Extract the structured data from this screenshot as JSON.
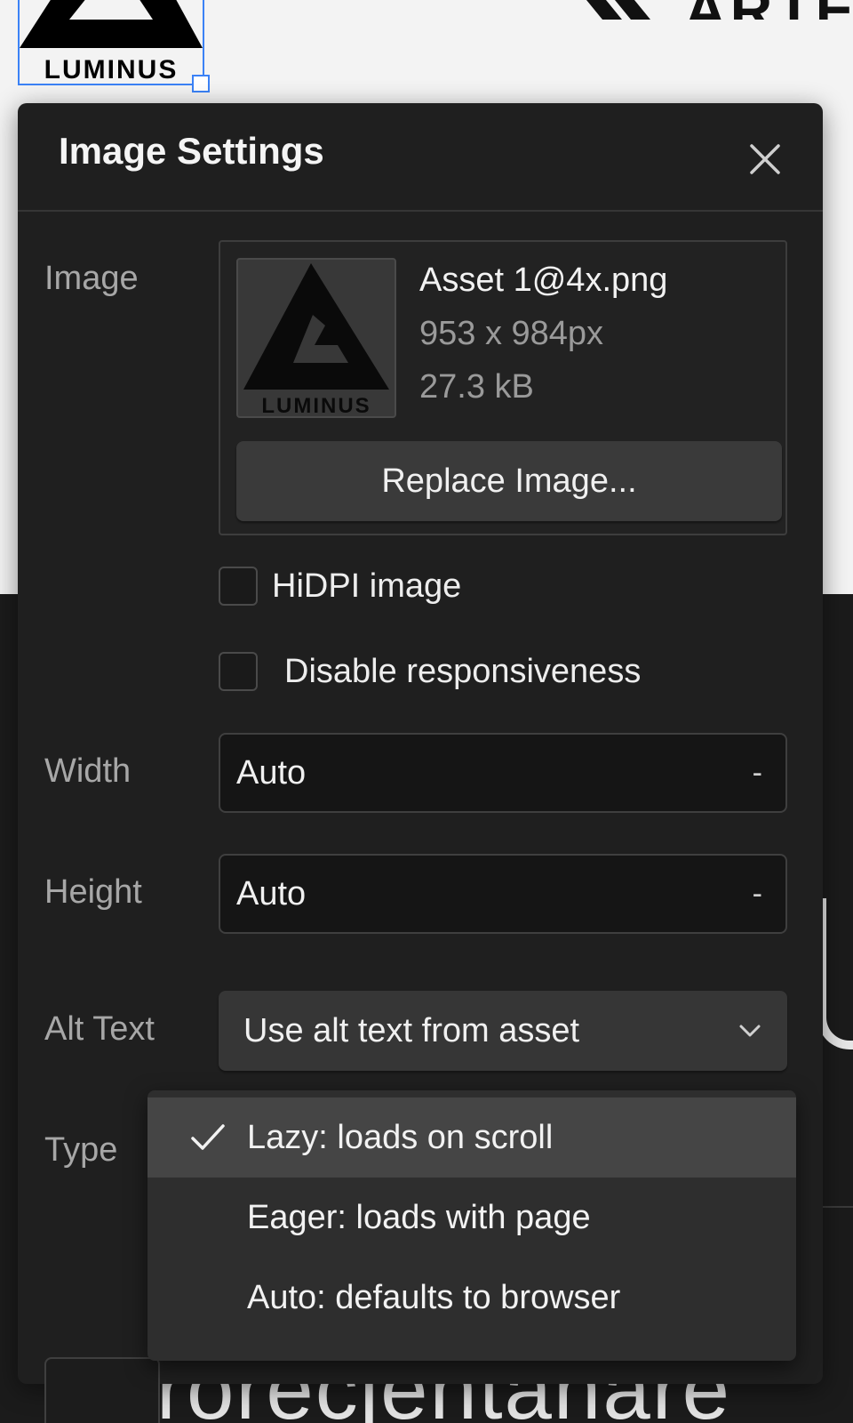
{
  "background": {
    "top_heading": "ARTE",
    "bottom_text": "Prorecjentanare"
  },
  "panel": {
    "title": "Image Settings",
    "image_field": {
      "label": "Image",
      "asset_name": "Asset 1@4x.png",
      "dimensions": "953 x 984px",
      "file_size": "27.3 kB",
      "replace_label": "Replace Image...",
      "logo_text": "LUMINUS"
    },
    "hidpi": {
      "label": "HiDPI image",
      "checked": false
    },
    "disable_responsive": {
      "label": "Disable responsiveness",
      "checked": false
    },
    "width": {
      "label": "Width",
      "value": "Auto",
      "unit": "-"
    },
    "height": {
      "label": "Height",
      "value": "Auto",
      "unit": "-"
    },
    "alt_text": {
      "label": "Alt Text",
      "value": "Use alt text from asset"
    },
    "type": {
      "label": "Type",
      "options": [
        {
          "label": "Lazy: loads on scroll",
          "selected": true
        },
        {
          "label": "Eager: loads with page",
          "selected": false
        },
        {
          "label": "Auto: defaults to browser",
          "selected": false
        }
      ]
    }
  },
  "colors": {
    "panel_bg": "#1f1f1f",
    "selection_blue": "#3b82f6",
    "menu_highlight": "#454545"
  }
}
